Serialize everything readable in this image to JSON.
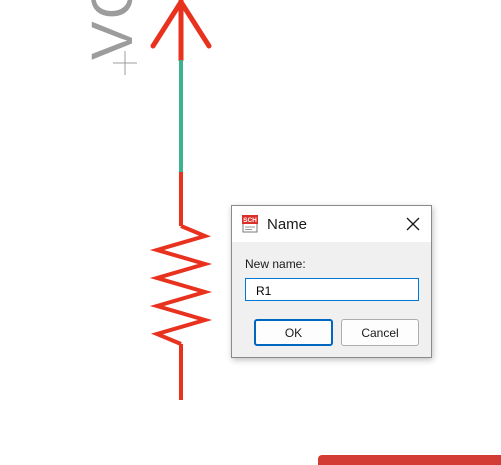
{
  "schematic": {
    "net_label": "VCC",
    "wire_color": "#e8321e",
    "net_color": "#3cb38f",
    "label_color": "#9c9c9c"
  },
  "dialog": {
    "icon": "sch-icon",
    "icon_text": "SCH",
    "title": "Name",
    "close_icon": "close-icon",
    "field_label": "New name:",
    "input_value": "R1",
    "ok_label": "OK",
    "cancel_label": "Cancel"
  }
}
